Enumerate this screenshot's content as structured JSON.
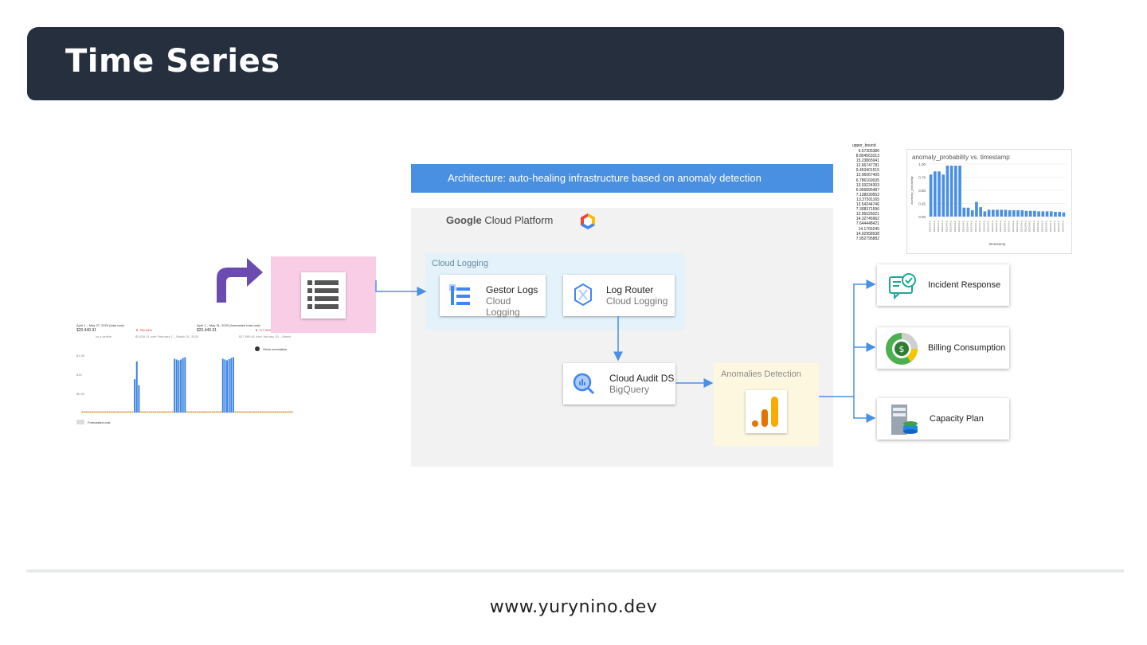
{
  "slide": {
    "title": "Time Series",
    "footer": "www.yurynino.dev"
  },
  "architecture": {
    "banner": "Architecture: auto-healing infrastructure based on anomaly detection",
    "platform_brand": "Google",
    "platform_name": "Cloud Platform",
    "cloud_logging_label": "Cloud Logging",
    "nodes": [
      {
        "title": "Gestor Logs",
        "subtitle": "Cloud Logging",
        "icon": "logging-icon"
      },
      {
        "title": "Log Router",
        "subtitle": "Cloud Logging",
        "icon": "log-router-icon"
      },
      {
        "title": "Cloud Audit DS",
        "subtitle": "BigQuery",
        "icon": "bigquery-icon"
      }
    ],
    "anomalies_label": "Anomalies Detection",
    "outputs": [
      {
        "label": "Incident Response",
        "icon": "incident-response-icon"
      },
      {
        "label": "Billing Consumption",
        "icon": "billing-icon"
      },
      {
        "label": "Capacity Plan",
        "icon": "capacity-plan-icon"
      }
    ],
    "colors": {
      "banner": "#4a90e2",
      "arrow": "#4a90e2",
      "cloud_logging_bg": "#e3f2fb",
      "anomalies_bg": "#fdf7e0",
      "source_bg": "#f9cde6",
      "turn_arrow": "#6b4bb0"
    }
  },
  "billing_thumbnail": {
    "left_header": "April 1 – May 27, 2020 (total cost)",
    "left_value": "$20,440.91",
    "left_change": "▼ 756.63%",
    "left_caption": "vs a similar",
    "left_range": "$3,826.11 over February 1 – March 31, 2020",
    "right_header": "April 1 – May 31, 2020 (forecasted total cost)",
    "right_value": "$20,440.91",
    "right_change": "▼ 717.55%",
    "right_range": "$17,989.91 over January 30 – March",
    "toggle_label": "Show cumulative",
    "legend_label": "Forecasted cost",
    "y_ticks": [
      "$1.5K",
      "$1K",
      "$0.5K",
      "$0"
    ],
    "chart_data": {
      "type": "bar",
      "values": [
        0,
        0,
        0,
        0,
        0,
        0,
        0,
        0,
        0,
        0,
        0,
        0,
        0,
        0,
        0,
        0,
        0,
        0,
        0,
        0,
        0,
        0,
        0,
        0,
        0,
        0,
        0,
        0,
        0,
        0,
        0,
        0,
        0,
        0,
        0,
        0,
        0,
        0,
        0,
        0,
        0,
        0,
        0,
        0,
        0,
        0,
        0,
        0,
        0,
        0,
        0,
        0,
        0,
        0,
        0,
        0,
        0,
        0,
        0,
        0,
        0,
        0,
        0,
        0,
        0,
        0,
        0,
        0,
        0,
        0,
        0,
        0,
        0,
        0,
        0,
        0,
        0,
        0,
        0,
        0,
        0,
        0,
        0,
        0,
        0,
        0,
        0,
        0,
        0,
        0,
        0,
        0,
        0,
        0,
        0,
        0,
        0,
        0,
        0,
        0,
        0
      ],
      "spikes": [
        {
          "index": 25,
          "value": 880
        },
        {
          "index": 26,
          "value": 1350
        },
        {
          "index": 27,
          "value": 720
        },
        {
          "index": 44,
          "value": 1420
        },
        {
          "index": 45,
          "value": 1400
        },
        {
          "index": 46,
          "value": 1380
        },
        {
          "index": 47,
          "value": 1400
        },
        {
          "index": 48,
          "value": 1440
        },
        {
          "index": 49,
          "value": 1460
        },
        {
          "index": 67,
          "value": 1420
        },
        {
          "index": 68,
          "value": 1400
        },
        {
          "index": 69,
          "value": 1380
        },
        {
          "index": 70,
          "value": 1410
        },
        {
          "index": 71,
          "value": 1440
        },
        {
          "index": 72,
          "value": 1460
        }
      ],
      "ylim": [
        0,
        1600
      ]
    }
  },
  "anomaly_sheet": {
    "column_header": "upper_bound",
    "column_values": [
      "9.57305386",
      "8.804563313",
      "15.23865941",
      "12.66747781",
      "9.453401515",
      "12.96067405",
      "6.786169935",
      "13.03224303",
      "6.966895487",
      "7.138930552",
      "13.37301165",
      "13.54244746",
      "7.308371596",
      "12.95025021",
      "14.32745962",
      "7.644448421",
      "14.1765245",
      "14.02958938",
      "7.952795882"
    ],
    "chart_data": {
      "type": "bar",
      "title": "anomaly_probability vs. timestamp",
      "xlabel": "timestamp",
      "ylabel": "anomaly_probability",
      "y_ticks": [
        "1.00",
        "0.75",
        "0.50",
        "0.25",
        "0.00"
      ],
      "ylim": [
        0,
        1
      ],
      "values": [
        0.8,
        0.86,
        0.86,
        0.8,
        0.97,
        0.97,
        0.97,
        0.97,
        0.17,
        0.17,
        0.12,
        0.28,
        0.18,
        0.1,
        0.13,
        0.13,
        0.13,
        0.13,
        0.13,
        0.12,
        0.12,
        0.12,
        0.12,
        0.11,
        0.11,
        0.11,
        0.1,
        0.1,
        0.1,
        0.1,
        0.09,
        0.09,
        0.08
      ],
      "x_tick_label": "2023-04-2..."
    }
  }
}
